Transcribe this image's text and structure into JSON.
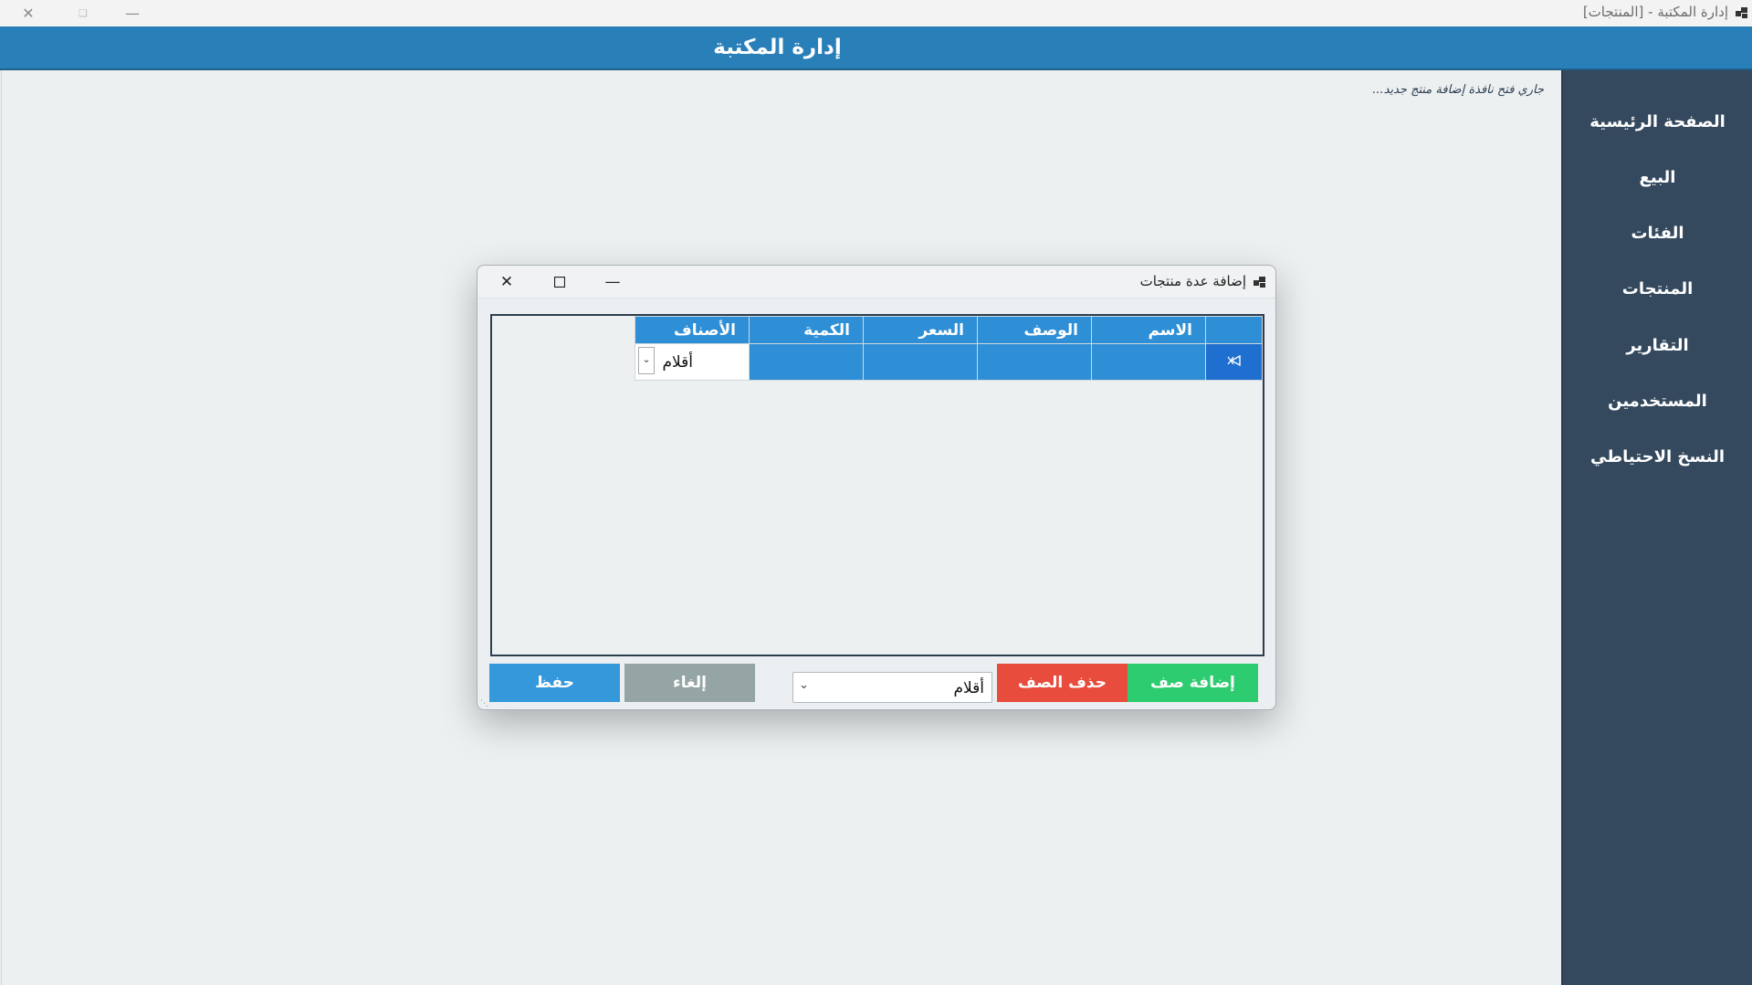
{
  "window": {
    "title": "إدارة المكتبة - [المنتجات]",
    "minimize_icon": "minimize-icon",
    "restore_icon": "restore-icon",
    "close_icon": "close-icon"
  },
  "header": {
    "title": "إدارة المكتبة"
  },
  "sidebar": {
    "items": [
      {
        "label": "الصفحة الرئيسية"
      },
      {
        "label": "البيع"
      },
      {
        "label": "الفئات"
      },
      {
        "label": "المنتجات"
      },
      {
        "label": "التقارير"
      },
      {
        "label": "المستخدمين"
      },
      {
        "label": "النسخ الاحتياطي"
      }
    ]
  },
  "content": {
    "status_text": "جاري فتح نافذة إضافة منتج جديد..."
  },
  "dialog": {
    "title": "إضافة عدة منتجات",
    "grid": {
      "columns": [
        "الاسم",
        "الوصف",
        "السعر",
        "الكمية",
        "الأصناف"
      ],
      "rows": [
        {
          "name": "",
          "description": "",
          "price": "",
          "quantity": "",
          "category": "أقلام"
        }
      ]
    },
    "buttons": {
      "add_row": "إضافة صف",
      "delete_row": "حذف الصف",
      "cancel": "إلغاء",
      "save": "حفظ"
    },
    "category_select": {
      "value": "أقلام"
    }
  },
  "colors": {
    "header": "#2980b9",
    "sidebar": "#34495e",
    "grid_header": "#2e8fd6",
    "add_row": "#2ecc71",
    "delete_row": "#e74c3c",
    "cancel": "#95a5a6",
    "save": "#3498db"
  }
}
